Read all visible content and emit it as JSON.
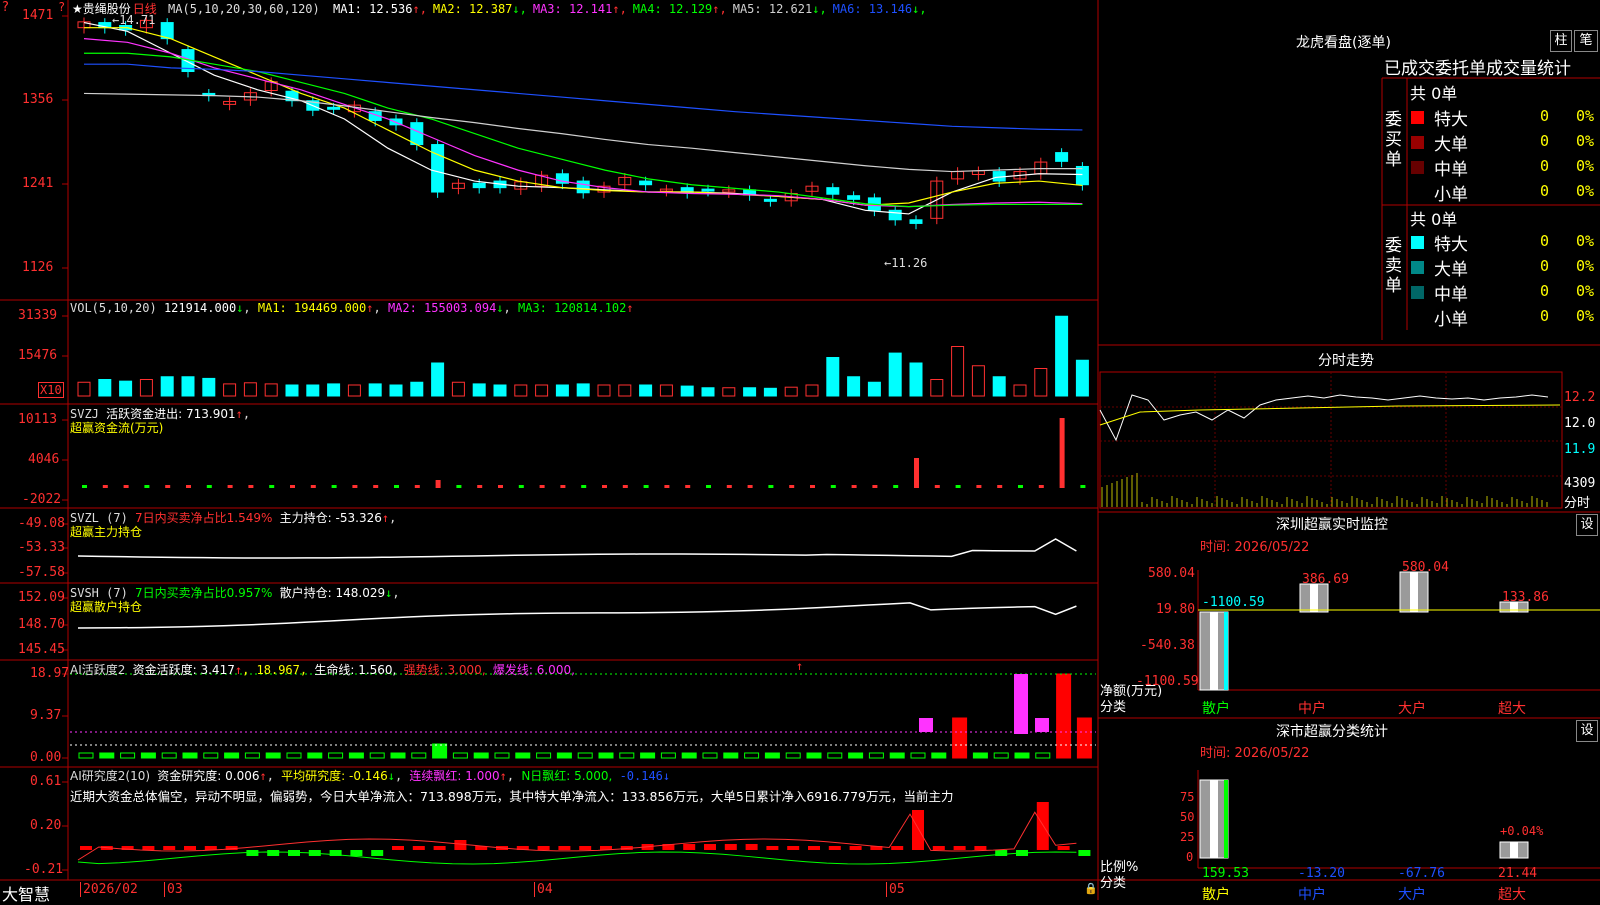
{
  "header": {
    "star": "★",
    "stock_name": "贵绳股份",
    "period": "日线",
    "ma_label": "MA(5,10,20,30,60,120)",
    "ma": [
      {
        "label": "MA1:",
        "value": "12.536",
        "arrow": "↑",
        "color": "#ffffff"
      },
      {
        "label": "MA2:",
        "value": "12.387",
        "arrow": "↓",
        "color": "#ffff00"
      },
      {
        "label": "MA3:",
        "value": "12.141",
        "arrow": "↑",
        "color": "#ff33ff"
      },
      {
        "label": "MA4:",
        "value": "12.129",
        "arrow": "↑",
        "color": "#00ff00"
      },
      {
        "label": "MA5:",
        "value": "12.621",
        "arrow": "↓",
        "color": "#d0d0d0"
      },
      {
        "label": "MA6:",
        "value": "13.146",
        "arrow": "↓",
        "color": "#1e50ff"
      }
    ],
    "high_note": "14.71",
    "low_note": "11.26"
  },
  "price_axis": [
    "1471",
    "1356",
    "1241",
    "1126"
  ],
  "vol_panel": {
    "title": "VOL(5,10,20)",
    "value": "121914.000",
    "arrow": "↓",
    "ma1": "MA1: 194469.000",
    "ma1_arrow": "↑",
    "ma2": "MA2: 155003.094",
    "ma2_arrow": "↓",
    "ma3": "MA3: 120814.102",
    "ma3_arrow": "↑",
    "axis": [
      "31339",
      "15476"
    ],
    "unit": "X10"
  },
  "svzj_panel": {
    "title": "SVZJ",
    "label": "活跃资金进出: 713.901",
    "arrow": "↑",
    "comma": ",",
    "subtitle": "超赢资金流(万元)",
    "axis": [
      "10113",
      "4046",
      "-2022"
    ]
  },
  "svzl_panel": {
    "title": "SVZL (7)",
    "label7": "7日内买卖净占比1.549%",
    "main": "主力持仓: -53.326",
    "arrow": "↑",
    "comma": ",",
    "subtitle": "超赢主力持仓",
    "axis": [
      "-49.08",
      "-53.33",
      "-57.58"
    ]
  },
  "svsh_panel": {
    "title": "SVSH (7)",
    "label7": "7日内买卖净占比0.957%",
    "main": "散户持仓: 148.029",
    "arrow": "↓",
    "comma": ",",
    "subtitle": "超赢散户持仓",
    "axis": [
      "152.09",
      "148.70",
      "145.45"
    ]
  },
  "ai_active_panel": {
    "title": "AI活跃度2",
    "label": "资金活跃度: 3.417",
    "arrow1": "↑",
    "v2": ", 18.967,",
    "life": "生命线: 1.560,",
    "strong": "强势线: 3.000,",
    "burst": "爆发线: 6.000,",
    "axis": [
      "18.97",
      "9.37",
      "0.00"
    ]
  },
  "ai_research_panel": {
    "title": "AI研究度2(10)",
    "label": "资金研究度: 0.006",
    "arrow1": "↑",
    "avg": "平均研究度: -0.146",
    "avg_arrow": "↓",
    "lianxu": "连续飘红: 1.000",
    "lianxu_arrow": "↑",
    "nri": "N日飘红: 5.000,",
    "tail": "-0.146",
    "tail_arrow": "↓",
    "desc": "近期大资金总体偏空，异动不明显，偏弱势，今日大单净流入：713.898万元，其中特大单净流入：133.856万元，大单5日累计净入6916.779万元，当前主力",
    "axis": [
      "0.61",
      "0.20",
      "-0.21"
    ]
  },
  "bottom_bar": {
    "brand": "大智慧",
    "dates": [
      "2026/02",
      "03",
      "04",
      "05"
    ]
  },
  "dragon": {
    "title": "龙虎看盘(逐单)",
    "btn_zhu": "柱",
    "btn_bi": "笔",
    "tabs": "已成交委托单成交量统计",
    "buy": {
      "side_label": "委买单",
      "count": "共 0单",
      "rows": [
        {
          "name": "特大",
          "num": "0",
          "pct": "0%",
          "color": "#ff0000"
        },
        {
          "name": "大单",
          "num": "0",
          "pct": "0%",
          "color": "#990000"
        },
        {
          "name": "中单",
          "num": "0",
          "pct": "0%",
          "color": "#660000"
        },
        {
          "name": "小单",
          "num": "0",
          "pct": "0%",
          "color": "#000000"
        }
      ]
    },
    "sell": {
      "side_label": "委卖单",
      "count": "共 0单",
      "rows": [
        {
          "name": "特大",
          "num": "0",
          "pct": "0%",
          "color": "#00ffff"
        },
        {
          "name": "大单",
          "num": "0",
          "pct": "0%",
          "color": "#008888"
        },
        {
          "name": "中单",
          "num": "0",
          "pct": "0%",
          "color": "#006666"
        },
        {
          "name": "小单",
          "num": "0",
          "pct": "0%",
          "color": "#000000"
        }
      ]
    }
  },
  "intraday": {
    "title": "分时走势",
    "axis": [
      "12.2",
      "12.0",
      "11.9",
      "4309"
    ],
    "footer": "分时"
  },
  "monitor": {
    "title": "深圳超赢实时监控",
    "btn": "设",
    "time": "时间: 2026/05/22",
    "axis": [
      "580.04",
      "19.80",
      "-540.38",
      "-1100.59"
    ],
    "ylabel": "净额(万元)",
    "xlabel": "分类",
    "cats": [
      "散户",
      "中户",
      "大户",
      "超大"
    ],
    "values": [
      "-1100.59",
      "386.69",
      "580.04",
      "133.86"
    ]
  },
  "category_stats": {
    "title": "深市超赢分类统计",
    "btn": "设",
    "time": "时间: 2026/05/22",
    "axis": [
      "75",
      "50",
      "25",
      "0"
    ],
    "ylabel": "比例%",
    "xlabel": "分类",
    "cats": [
      "散户",
      "中户",
      "大户",
      "超大"
    ],
    "values": [
      "159.53",
      "-13.20",
      "-67.76",
      "21.44"
    ],
    "note": "+0.04%"
  },
  "colors": {
    "up": "#ff0000",
    "down": "#00ffff",
    "grid": "#b00000",
    "axis_text": "#ff3030"
  }
}
